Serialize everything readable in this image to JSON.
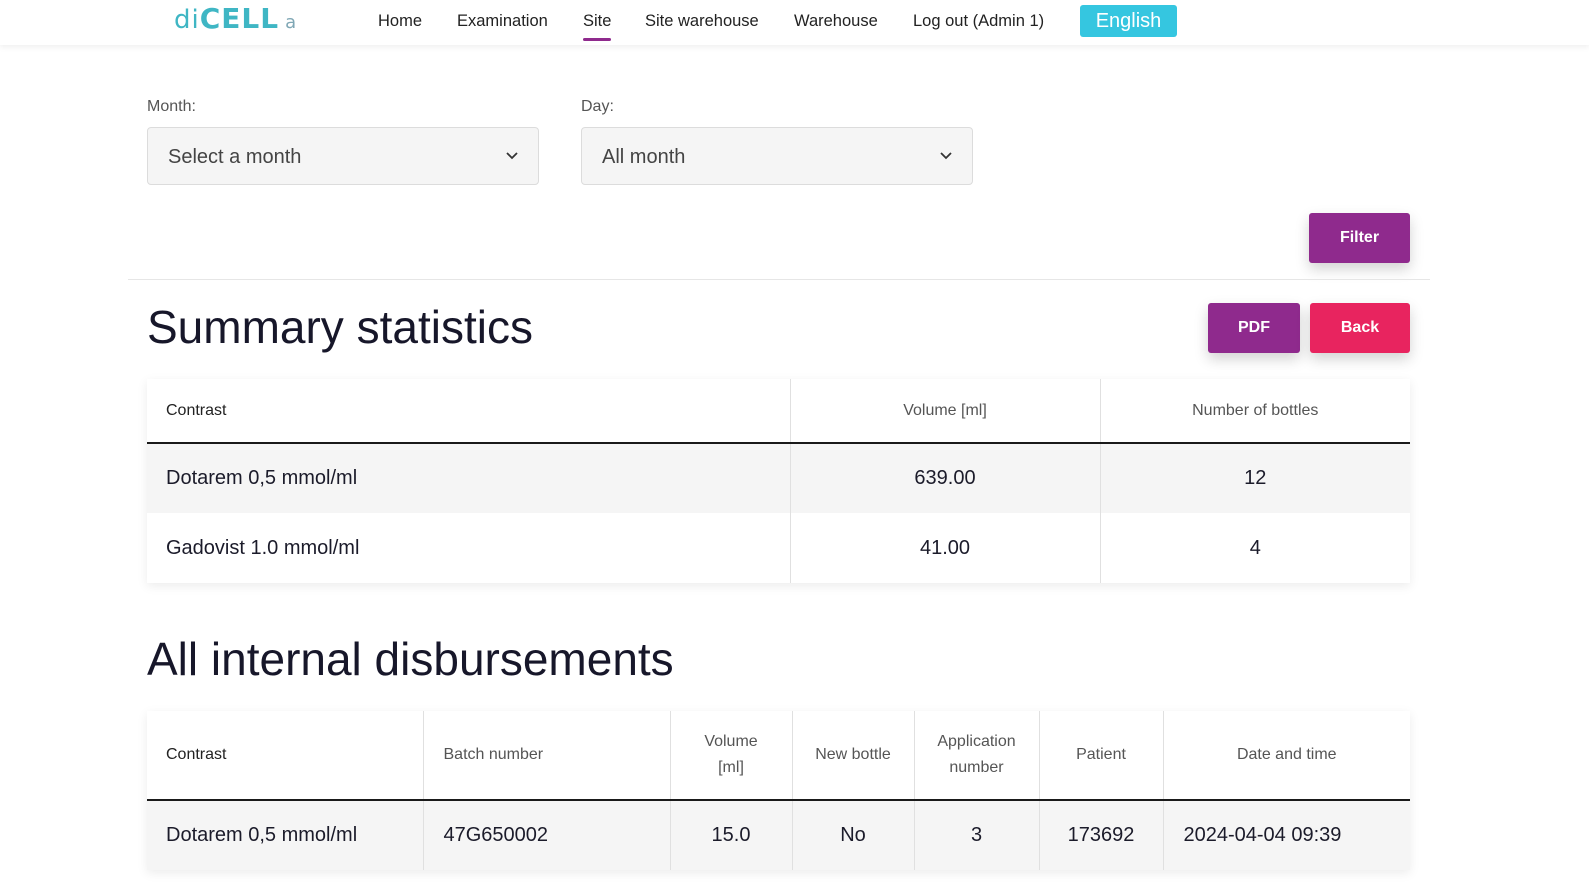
{
  "header": {
    "logo": {
      "part1": "di",
      "part2": "CELL",
      "part3": "a"
    },
    "nav": [
      "Home",
      "Examination",
      "Site",
      "Site warehouse",
      "Warehouse",
      "Log out (Admin 1)"
    ],
    "active_nav": "Site",
    "language": "English"
  },
  "filters": {
    "month_label": "Month:",
    "month_value": "Select a month",
    "day_label": "Day:",
    "day_value": "All month",
    "filter_button": "Filter"
  },
  "summary": {
    "title": "Summary statistics",
    "pdf_button": "PDF",
    "back_button": "Back",
    "columns": [
      "Contrast",
      "Volume [ml]",
      "Number of bottles"
    ],
    "rows": [
      [
        "Dotarem 0,5 mmol/ml",
        "639.00",
        "12"
      ],
      [
        "Gadovist 1.0 mmol/ml",
        "41.00",
        "4"
      ]
    ]
  },
  "disbursements": {
    "title": "All internal disbursements",
    "columns": [
      "Contrast",
      "Batch number",
      "Volume [ml]",
      "New bottle",
      "Application number",
      "Patient",
      "Date and time"
    ],
    "rows": [
      [
        "Dotarem 0,5 mmol/ml",
        "47G650002",
        "15.0",
        "No",
        "3",
        "173692",
        "2024-04-04 09:39"
      ]
    ]
  },
  "colors": {
    "brand_purple": "#8f2a8d",
    "back_red": "#e8245f",
    "lang_cyan": "#35c6e0",
    "logo_teal": "#3fb6c4"
  }
}
